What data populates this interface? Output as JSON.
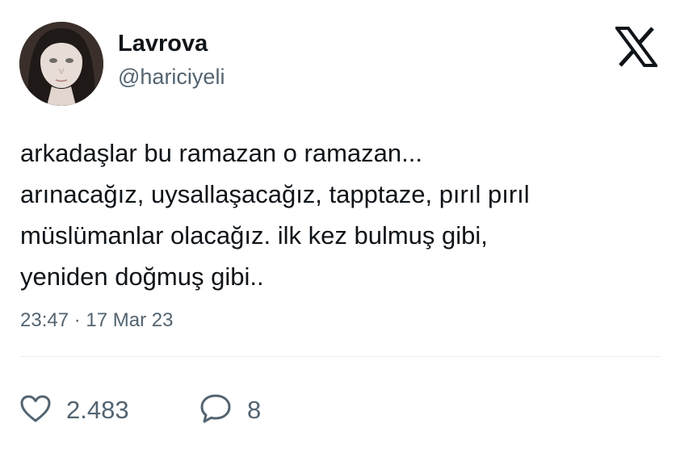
{
  "author": {
    "display_name": "Lavrova",
    "handle": "@hariciyeli",
    "avatar_icon": "avatar-photo"
  },
  "platform": {
    "logo_icon": "x-logo-icon"
  },
  "tweet": {
    "lines": [
      "arkadaşlar bu ramazan o ramazan...",
      "arınacağız, uysallaşacağız, tapptaze, pırıl pırıl",
      "müslümanlar olacağız. ilk kez bulmuş gibi,",
      "yeniden doğmuş gibi.."
    ],
    "timestamp": "23:47 · 17 Mar 23"
  },
  "actions": {
    "like_count": "2.483",
    "like_icon": "heart-icon",
    "reply_count": "8",
    "reply_icon": "speech-bubble-icon"
  },
  "colors": {
    "text_primary": "#0f1419",
    "text_secondary": "#536471",
    "divider": "#e6ebee"
  }
}
